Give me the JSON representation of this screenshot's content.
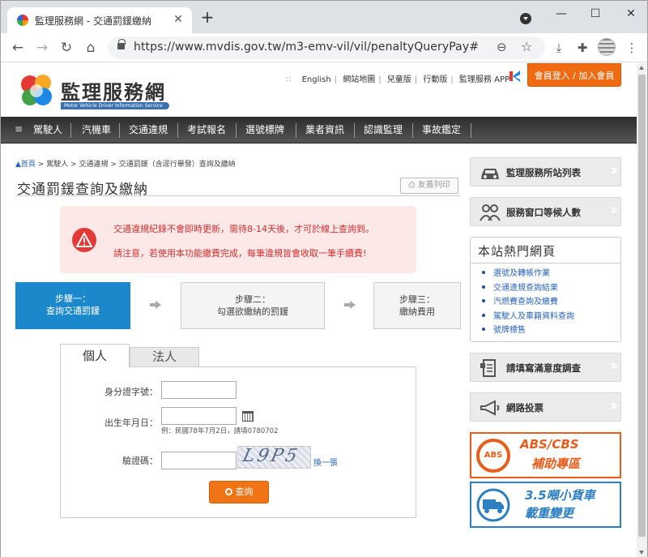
{
  "browser": {
    "tab_title": "監理服務網 - 交通罰鍰繳納",
    "url": "https://www.mvdis.gov.tw/m3-emv-vil/vil/penaltyQueryPay#",
    "icons": [
      "favicon-icon",
      "close-icon",
      "plus-icon",
      "tab-search-icon",
      "minimize-icon",
      "maximize-icon",
      "close-window-icon",
      "back-icon",
      "forward-icon",
      "reload-icon",
      "home-icon",
      "lock-icon",
      "zoom-icon",
      "star-icon",
      "download-icon",
      "extensions-icon",
      "profile-icon",
      "more-icon"
    ]
  },
  "header": {
    "logo_text": "監理服務網",
    "logo_subtitle": "Motor Vehicle Driver Information Service",
    "top_links": [
      "English",
      "網站地圖",
      "兒童版",
      "行動版",
      "監理服務 APP"
    ],
    "login_button": "會員登入 / 加入會員"
  },
  "nav": {
    "items": [
      "駕駛人",
      "汽機車",
      "交通違規",
      "考試報名",
      "選號標牌",
      "業者資訊",
      "認識監理",
      "事故鑑定"
    ]
  },
  "breadcrumb": {
    "home": "首頁",
    "rest": " > 駕駛人 > 交通違規 > 交通罰鍰（含逕行舉發）查詢及繳納"
  },
  "page": {
    "title": "交通罰鍰查詢及繳納",
    "print_button": "友善列印"
  },
  "alert": {
    "line1": "交通違規紀錄不會即時更新，需待8-14天後，才可於線上查詢到。",
    "line2": "請注意，若使用本功能繳費完成，每筆違規皆會收取一筆手續費!"
  },
  "steps": [
    {
      "line1": "步驟一：",
      "line2": "查詢交通罰鍰"
    },
    {
      "line1": "步驟二：",
      "line2": "勾選欲繳納的罰鍰"
    },
    {
      "line1": "步驟三：",
      "line2": "繳納費用"
    }
  ],
  "form": {
    "tabs": [
      "個人",
      "法人"
    ],
    "id_label": "身分證字號：",
    "id_value": "",
    "birth_label": "出生年月日：",
    "birth_value": "",
    "birth_hint": "例：民國78年7月2日，請填0780702",
    "captcha_label": "驗證碼：",
    "captcha_value": "",
    "captcha_image_text": "L9P5",
    "refresh_link": "換一張",
    "query_button": "查詢"
  },
  "sidebar": {
    "buttons": [
      "監理服務所站列表",
      "服務窗口等候人數",
      "請填寫滿意度調查",
      "網路投票"
    ],
    "hot_title": "本站熱門網頁",
    "hot_links": [
      "選號及轉帳作業",
      "交通違規查詢結果",
      "汽燃費查詢及繳費",
      "駕駛人及車籍資料查詢",
      "號牌標售"
    ],
    "banner_abs": {
      "badge": "ABS",
      "line1": "ABS/CBS",
      "line2": "補助專區"
    },
    "banner_truck": {
      "line1": "3.5噸小貨車",
      "line2": "載重變更"
    }
  },
  "colors": {
    "accent_orange": "#f07316",
    "step_active": "#1c88cc",
    "alert_bg": "#fde8e8",
    "alert_text": "#d32f2f",
    "link": "#2a64b8"
  }
}
